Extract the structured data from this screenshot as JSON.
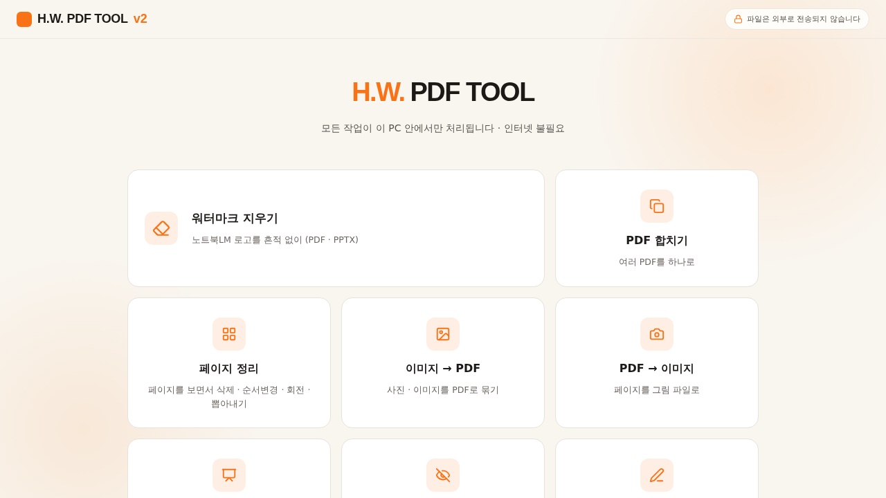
{
  "header": {
    "brand": "H.W. PDF TOOL",
    "version": "v2",
    "notice": "파일은 외부로 전송되지 않습니다"
  },
  "hero": {
    "title_accent": "H.W.",
    "title_rest": "PDF TOOL",
    "subtitle": "모든 작업이 이 PC 안에서만 처리됩니다 · 인터넷 불필요"
  },
  "tools": [
    {
      "kind": "wide",
      "title": "워터마크 지우기",
      "description": "노트북LM 로고를 흔적 없이 (PDF · PPTX)"
    },
    {
      "kind": "tile",
      "title": "PDF 합치기",
      "description": "여러 PDF를 하나로"
    },
    {
      "kind": "tile",
      "title": "페이지 정리",
      "description": "페이지를 보면서 삭제 · 순서변경 · 회전 · 뽑아내기"
    },
    {
      "kind": "tile",
      "title": "이미지 → PDF",
      "description": "사진 · 이미지를 PDF로 묶기"
    },
    {
      "kind": "tile",
      "title": "PDF → 이미지",
      "description": "페이지를 그림 파일로"
    },
    {
      "kind": "tile"
    },
    {
      "kind": "tile"
    },
    {
      "kind": "tile"
    }
  ]
}
